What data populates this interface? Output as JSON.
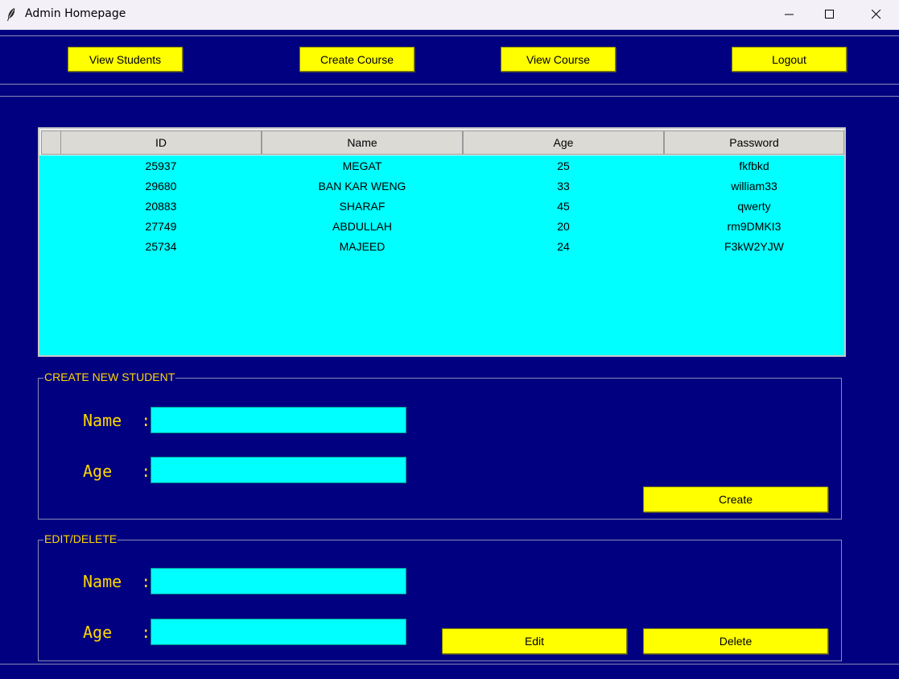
{
  "window": {
    "title": "Admin Homepage",
    "controls": [
      "minimize-icon",
      "maximize-icon",
      "close-icon"
    ]
  },
  "nav": {
    "view_students": "View Students",
    "create_course": "Create Course",
    "view_course": "View Course",
    "logout": "Logout"
  },
  "table": {
    "headers": [
      "ID",
      "Name",
      "Age",
      "Password"
    ],
    "rows": [
      {
        "id": "25937",
        "name": "MEGAT",
        "age": "25",
        "password": "fkfbkd"
      },
      {
        "id": "29680",
        "name": "BAN KAR WENG",
        "age": "33",
        "password": "william33"
      },
      {
        "id": "20883",
        "name": "SHARAF",
        "age": "45",
        "password": "qwerty"
      },
      {
        "id": "27749",
        "name": "ABDULLAH",
        "age": "20",
        "password": "rm9DMKI3"
      },
      {
        "id": "25734",
        "name": "MAJEED",
        "age": "24",
        "password": "F3kW2YJW"
      }
    ]
  },
  "create_section": {
    "title": "CREATE NEW STUDENT",
    "name_label": "Name  :",
    "age_label": "Age   :",
    "name_value": "",
    "age_value": "",
    "create_button": "Create"
  },
  "edit_section": {
    "title": "EDIT/DELETE",
    "name_label": "Name  :",
    "age_label": "Age   :",
    "name_value": "",
    "age_value": "",
    "edit_button": "Edit",
    "delete_button": "Delete"
  },
  "colors": {
    "background": "#000080",
    "button": "#ffff00",
    "field": "#00ffff",
    "label": "#ffd700"
  }
}
